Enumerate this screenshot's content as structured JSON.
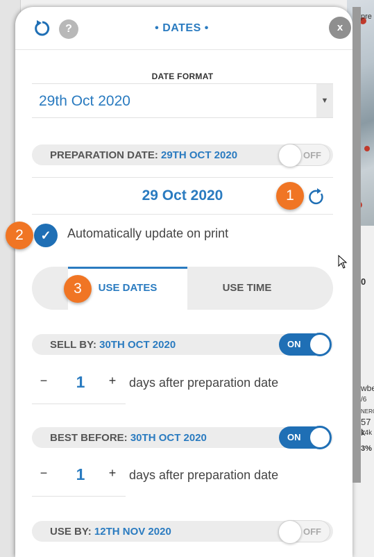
{
  "header": {
    "title": "• DATES •",
    "help_label": "?",
    "close_label": "x"
  },
  "date_format": {
    "label": "DATE FORMAT",
    "value": "29th Oct 2020",
    "arrow": "▼"
  },
  "preparation": {
    "label": "PREPARATION DATE: ",
    "value": "29TH OCT 2020",
    "toggle_label": "OFF",
    "toggle_state": "off",
    "date_display": "29 Oct 2020"
  },
  "auto_update": {
    "checked": true,
    "check_glyph": "✓",
    "label": "Automatically update on print"
  },
  "tabs": [
    {
      "label": "USE DATES",
      "active": true
    },
    {
      "label": "USE TIME",
      "active": false
    }
  ],
  "sell_by": {
    "label": "SELL BY: ",
    "value": "30TH OCT 2020",
    "toggle_label": "ON",
    "toggle_state": "on",
    "minus": "−",
    "plus": "+",
    "days": "1",
    "days_text": "days after preparation date"
  },
  "best_before": {
    "label": "BEST BEFORE: ",
    "value": "30TH OCT 2020",
    "toggle_label": "ON",
    "toggle_state": "on",
    "minus": "−",
    "plus": "+",
    "days": "1",
    "days_text": "days after preparation date"
  },
  "use_by": {
    "label": "USE BY: ",
    "value": "12TH NOV 2020",
    "toggle_label": "OFF",
    "toggle_state": "off"
  },
  "callouts": [
    "1",
    "2",
    "3"
  ],
  "background": {
    "fragments": [
      "pre",
      "0",
      "wbe",
      "/6",
      "NERG",
      "57 k",
      "14k",
      "3%"
    ]
  },
  "colors": {
    "accent": "#2a7bc0",
    "toggle_on": "#1f6fb5",
    "callout": "#f07524"
  },
  "icons": [
    "reset-icon",
    "help-icon",
    "close-icon",
    "refresh-icon",
    "check-icon",
    "mouse-cursor-icon"
  ]
}
